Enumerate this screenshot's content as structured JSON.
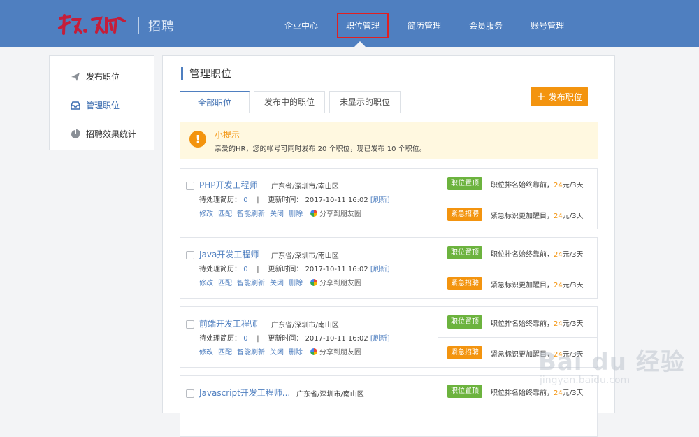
{
  "header": {
    "brand_text": "招聘",
    "logo_text": "拉勾网",
    "nav": [
      "企业中心",
      "职位管理",
      "简历管理",
      "会员服务",
      "账号管理"
    ],
    "active_nav": "职位管理"
  },
  "sidebar": {
    "items": [
      {
        "label": "发布职位",
        "icon": "paper-plane-icon"
      },
      {
        "label": "管理职位",
        "icon": "inbox-icon"
      },
      {
        "label": "招聘效果统计",
        "icon": "pie-chart-icon"
      }
    ],
    "active": "管理职位"
  },
  "main": {
    "title": "管理职位",
    "tabs": [
      "全部职位",
      "发布中的职位",
      "未显示的职位"
    ],
    "active_tab": "全部职位",
    "publish_button": "发布职位",
    "tip": {
      "title": "小提示",
      "body": "亲爱的HR，您的帐号可同时发布 20 个职位，现已发布 10 个职位。"
    }
  },
  "labels": {
    "pending": "待处理简历：",
    "updated": "更新时间：",
    "refresh": "[刷新]",
    "separator": "|",
    "actions": [
      "修改",
      "匹配",
      "智能刷新",
      "关闭",
      "删除"
    ],
    "share": "分享到朋友圈",
    "promo_top_badge": "职位置顶",
    "promo_top_text": "职位排名始终靠前，",
    "promo_urgent_badge": "紧急招聘",
    "promo_urgent_text": "紧急标识更加醒目，",
    "price": "24",
    "price_unit": "元/3天"
  },
  "jobs": [
    {
      "title": "PHP开发工程师",
      "location": "广东省/深圳市/南山区",
      "pending": "0",
      "updated": "2017-10-11 16:02"
    },
    {
      "title": "Java开发工程师",
      "location": "广东省/深圳市/南山区",
      "pending": "0",
      "updated": "2017-10-11 16:02"
    },
    {
      "title": "前端开发工程师",
      "location": "广东省/深圳市/南山区",
      "pending": "0",
      "updated": "2017-10-11 16:02"
    },
    {
      "title": "Javascript开发工程师...",
      "location": "广东省/深圳市/南山区"
    }
  ],
  "watermark": {
    "text": "Bai du 经验",
    "url": "jingyan.baidu.com"
  },
  "colors": {
    "header": "#4f7fc0",
    "accent": "#f3940f",
    "green": "#6cb33e",
    "link": "#4f7fc0"
  }
}
